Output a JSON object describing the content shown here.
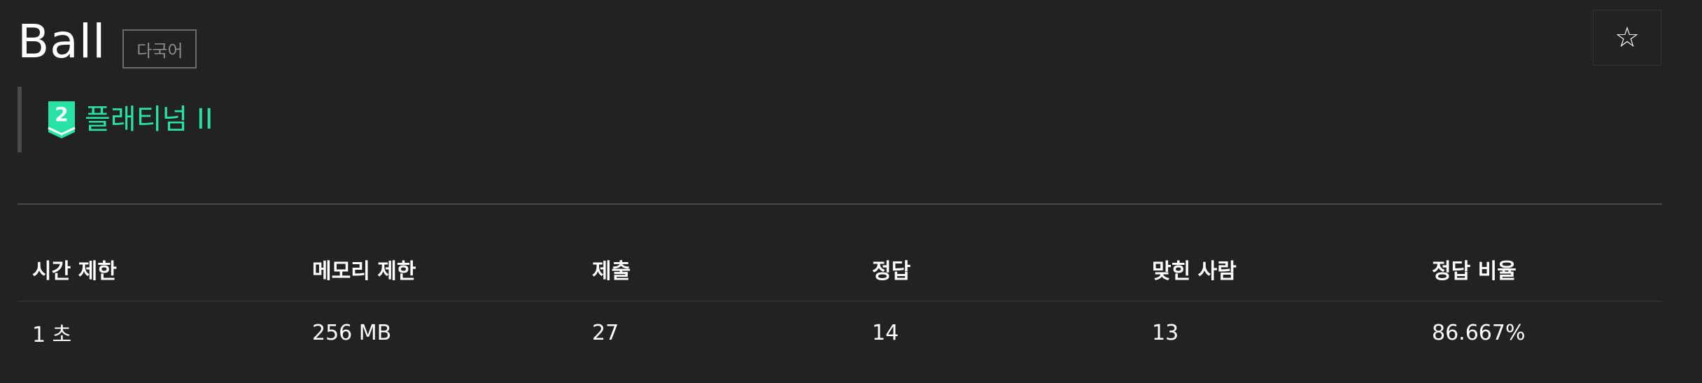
{
  "problem": {
    "title": "Ball",
    "language_badge": "다국어",
    "favorite_icon": "star-outline-icon"
  },
  "tier": {
    "icon": "platinum-tier-icon",
    "level_number": "2",
    "label": "플래티넘 II",
    "color": "#27e2a4"
  },
  "info": {
    "headers": [
      "시간 제한",
      "메모리 제한",
      "제출",
      "정답",
      "맞힌 사람",
      "정답 비율"
    ],
    "values": [
      "1 초",
      "256 MB",
      "27",
      "14",
      "13",
      "86.667%"
    ]
  }
}
